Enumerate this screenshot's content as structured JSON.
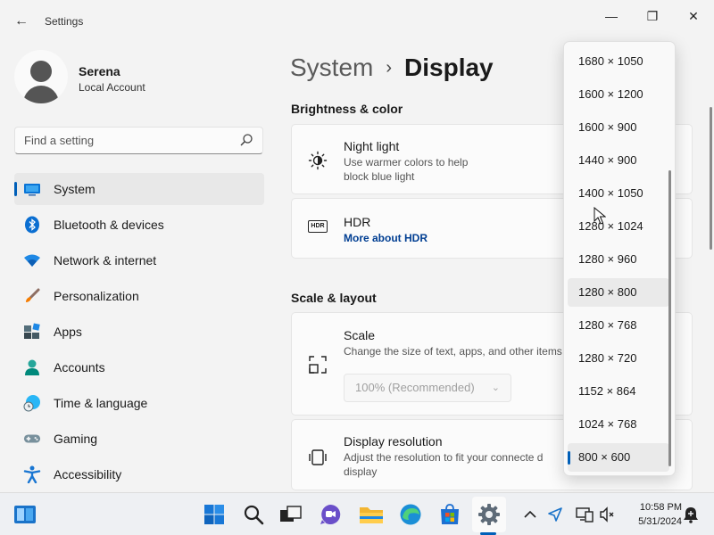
{
  "window": {
    "app_title": "Settings",
    "back_glyph": "←",
    "minimize_glyph": "—",
    "maximize_glyph": "❐",
    "close_glyph": "✕"
  },
  "user": {
    "name": "Serena",
    "account_type": "Local Account"
  },
  "search": {
    "placeholder": "Find a setting",
    "icon": "search-icon"
  },
  "sidebar": {
    "items": [
      {
        "label": "System",
        "icon": "system-icon",
        "active": true
      },
      {
        "label": "Bluetooth & devices",
        "icon": "bluetooth-icon"
      },
      {
        "label": "Network & internet",
        "icon": "wifi-icon"
      },
      {
        "label": "Personalization",
        "icon": "brush-icon"
      },
      {
        "label": "Apps",
        "icon": "apps-icon"
      },
      {
        "label": "Accounts",
        "icon": "accounts-icon"
      },
      {
        "label": "Time & language",
        "icon": "globe-clock-icon"
      },
      {
        "label": "Gaming",
        "icon": "gamepad-icon"
      },
      {
        "label": "Accessibility",
        "icon": "accessibility-icon"
      }
    ]
  },
  "breadcrumb": {
    "parent": "System",
    "separator": "›",
    "current": "Display"
  },
  "sections": {
    "brightness": "Brightness & color",
    "scale_layout": "Scale & layout"
  },
  "night_light": {
    "title": "Night light",
    "description": "Use warmer colors to help block blue light"
  },
  "hdr": {
    "title": "HDR",
    "link": "More about HDR",
    "icon_text": "HDR"
  },
  "scale": {
    "title": "Scale",
    "description": "Change the size of text, apps, and other items",
    "value": "100% (Recommended)",
    "chevron": "⌄"
  },
  "display_resolution": {
    "title": "Display resolution",
    "description": "Adjust the resolution to fit your connecte d display"
  },
  "resolution_dropdown": {
    "options": [
      "1680 × 1050",
      "1600 × 1200",
      "1600 × 900",
      "1440 × 900",
      "1400 × 1050",
      "1280 × 1024",
      "1280 × 960",
      "1280 × 800",
      "1280 × 768",
      "1280 × 720",
      "1152 × 864",
      "1024 × 768",
      "800 × 600"
    ],
    "selected": "800 × 600",
    "hovered": "1280 × 800"
  },
  "taskbar": {
    "icons": [
      "widgets-icon",
      "start-icon",
      "search-icon",
      "task-view-icon",
      "chat-icon",
      "file-explorer-icon",
      "edge-icon",
      "store-icon",
      "settings-icon"
    ],
    "tray": [
      "chevron-up-icon",
      "location-icon",
      "network-icon",
      "volume-muted-icon",
      "notification-icon"
    ],
    "time": "10:58 PM",
    "date": "5/31/2024"
  },
  "colors": {
    "accent": "#005fb8",
    "link": "#003e92"
  }
}
